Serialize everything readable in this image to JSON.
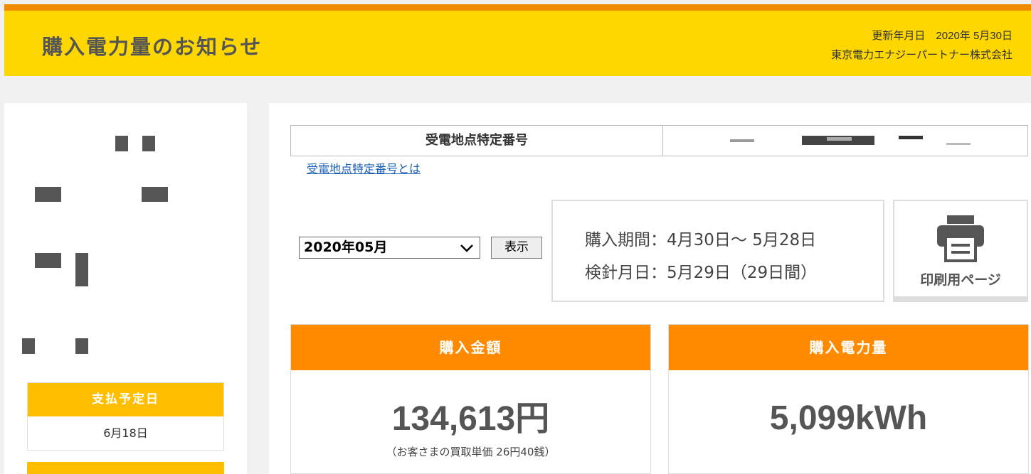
{
  "header": {
    "title": "購入電力量のお知らせ",
    "update_date": "更新年月日　2020年 5月30日",
    "company": "東京電力エナジーパートナー株式会社"
  },
  "payment": {
    "heading": "支払予定日",
    "date": "6月18日"
  },
  "meter_point": {
    "label": "受電地点特定番号",
    "help_link": "受電地点特定番号とは"
  },
  "month_select": {
    "selected": "2020年05月",
    "button": "表示"
  },
  "period": {
    "purchase_label": "購入期間",
    "purchase_value": "4月30日～ 5月28日",
    "reading_label": "検針月日",
    "reading_value": "5月29日（29日間）"
  },
  "print": {
    "label": "印刷用ページ",
    "icon": "printer-icon"
  },
  "amount_card": {
    "heading": "購入金額",
    "value": "134,613円",
    "note": "（お客さまの買取単価 26円40銭）"
  },
  "energy_card": {
    "heading": "購入電力量",
    "value": "5,099kWh"
  },
  "colors": {
    "header_yellow": "#ffd700",
    "stripe_orange": "#f08a00",
    "card_orange": "#ff8a00",
    "pay_yellow": "#ffbf00",
    "link_blue": "#1a5fb4"
  }
}
